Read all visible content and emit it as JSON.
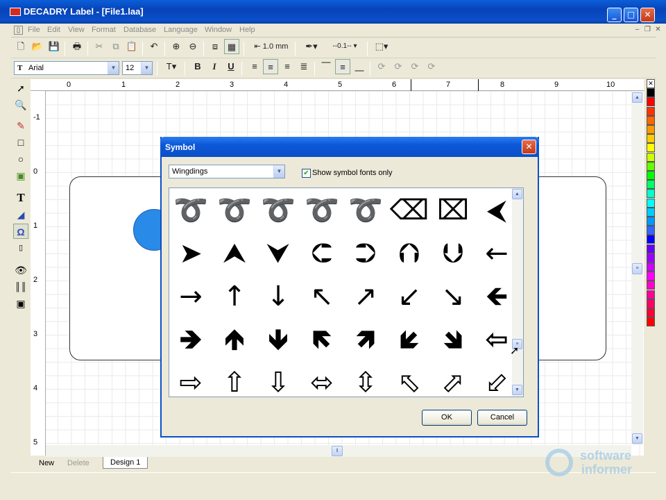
{
  "window": {
    "title": "DECADRY Label - [File1.laa]",
    "minimize": "_",
    "maximize": "□",
    "close": "✕"
  },
  "menu": [
    "File",
    "Edit",
    "View",
    "Format",
    "Database",
    "Language",
    "Window",
    "Help"
  ],
  "toolbar1": {
    "line_width": "1.0 mm",
    "line_style": "--0.1--",
    "icons": [
      "new-icon",
      "open-icon",
      "save-icon",
      "print-icon",
      "cut-icon",
      "copy-icon",
      "paste-icon",
      "undo-icon",
      "zoom-in-icon",
      "zoom-out-icon",
      "page-icon",
      "grid-icon",
      "line-width-icon",
      "line-color-icon",
      "line-style-icon",
      "fill-icon"
    ]
  },
  "toolbar2": {
    "font": "Arial",
    "font_size": "12",
    "bold": "B",
    "italic": "I",
    "underline": "U"
  },
  "ruler": {
    "h": [
      "0",
      "1",
      "2",
      "3",
      "4",
      "5",
      "6",
      "7",
      "8",
      "9",
      "10"
    ],
    "v": [
      "-1",
      "0",
      "1",
      "2",
      "3",
      "4",
      "5"
    ]
  },
  "tabs": {
    "new": "New",
    "delete": "Delete",
    "design": "Design 1"
  },
  "dialog": {
    "title": "Symbol",
    "font_select": "Wingdings",
    "checkbox_label": "Show symbol fonts only",
    "checkbox_checked": true,
    "ok": "OK",
    "cancel": "Cancel",
    "symbols": [
      "➰",
      "➰",
      "➰",
      "➰",
      "➰",
      "⌫",
      "⌧",
      "⮜",
      "➤",
      "⮝",
      "⮟",
      "⮈",
      "⮊",
      "⮉",
      "⮋",
      "←",
      "→",
      "↑",
      "↓",
      "↖",
      "↗",
      "↙",
      "↘",
      "🡸",
      "🡺",
      "🡹",
      "🡻",
      "🡼",
      "🡽",
      "🡿",
      "🡾",
      "⇦",
      "⇨",
      "⇧",
      "⇩",
      "⬄",
      "⇳",
      "⬁",
      "⬀",
      "⬃"
    ]
  },
  "colors": [
    "#ffffff",
    "#000000",
    "#ff0000",
    "#ff3300",
    "#ff6600",
    "#ff9900",
    "#ffcc00",
    "#ffff00",
    "#ccff00",
    "#66ff00",
    "#00ff00",
    "#00ff66",
    "#00ffcc",
    "#00ffff",
    "#00ccff",
    "#0099ff",
    "#3366ff",
    "#0000ff",
    "#6600ff",
    "#9900ff",
    "#cc00ff",
    "#ff00ff",
    "#ff00cc",
    "#ff0099",
    "#ff0066",
    "#ff0033",
    "#ff0000"
  ],
  "watermark": {
    "line1": "software",
    "line2": "informer"
  }
}
